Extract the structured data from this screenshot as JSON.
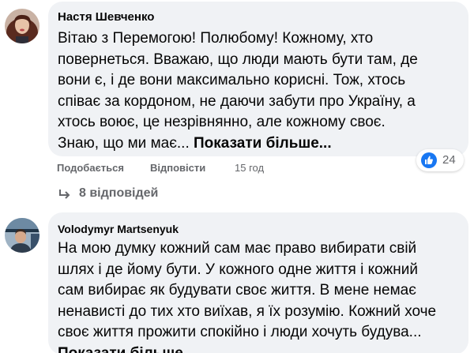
{
  "comments": [
    {
      "author": "Настя Шевченко",
      "avatar_icon": "user-photo-woman",
      "lines": [
        "Вітаю з Перемогою! Полюбому! Кожному, хто",
        "повернеться. Вважаю, що люди мають бути там, де",
        "вони є, і де вони максимально корисні. Тож, хтось",
        "співає за кордоном, не даючи забути про Україну, а",
        "хтось воює, це незрівнянно, але кожному своє.",
        "Знаю, що ми має..."
      ],
      "show_more": "Показати більше...",
      "actions": {
        "like": "Подобається",
        "reply": "Відповісти",
        "time": "15 год"
      },
      "reactions": {
        "icon": "like-icon",
        "count": "24"
      },
      "replies": {
        "icon": "reply-arrow-icon",
        "label": "8 відповідей"
      }
    },
    {
      "author": "Volodymyr Martsenyuk",
      "avatar_icon": "user-photo-man",
      "lines": [
        "На мою думку кожний сам має право вибирати свій",
        "шлях і де йому бути. У кожного одне життя і кожний",
        "сам вибирає як будувати своє життя. В мене немає",
        "ненависті до тих хто виїхав, я їх розумію. Кожний хоче",
        "своє життя прожити спокійно і люди хочуть будува..."
      ],
      "show_more": "Показати більше"
    }
  ],
  "colors": {
    "bubble": "#f0f2f5",
    "secondary_text": "#65676b",
    "like_blue": "#1877f2"
  }
}
